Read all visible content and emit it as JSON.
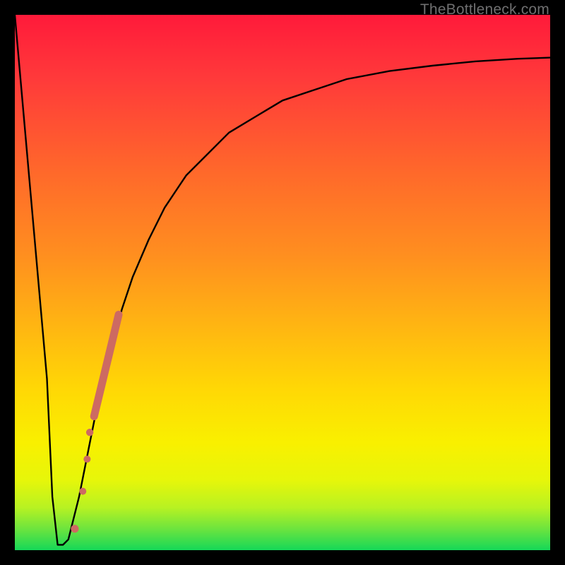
{
  "watermark": "TheBottleneck.com",
  "chart_data": {
    "type": "line",
    "title": "",
    "xlabel": "",
    "ylabel": "",
    "xlim": [
      0,
      100
    ],
    "ylim": [
      0,
      100
    ],
    "grid": false,
    "legend": false,
    "annotations": [
      {
        "text": "TheBottleneck.com",
        "position": "top-right"
      }
    ],
    "series": [
      {
        "name": "curve",
        "x": [
          0,
          6,
          7,
          8,
          9,
          10,
          12,
          14,
          16,
          18,
          20,
          22,
          25,
          28,
          32,
          36,
          40,
          45,
          50,
          56,
          62,
          70,
          78,
          86,
          94,
          100
        ],
        "values": [
          100,
          32,
          10,
          1,
          1,
          2,
          10,
          20,
          30,
          38,
          45,
          51,
          58,
          64,
          70,
          74,
          78,
          81,
          84,
          86,
          88,
          89.5,
          90.5,
          91.3,
          91.8,
          92
        ]
      }
    ],
    "points": [
      {
        "x": 14.0,
        "y": 22.0,
        "r": 2.6
      },
      {
        "x": 13.5,
        "y": 17.0,
        "r": 2.6
      },
      {
        "x": 12.7,
        "y": 11.0,
        "r": 2.6
      },
      {
        "x": 11.2,
        "y": 4.0,
        "r": 2.8
      }
    ],
    "thick_segment": {
      "x_start": 14.8,
      "y_start": 25.0,
      "x_end": 19.4,
      "y_end": 44.0
    },
    "background_gradient": {
      "orientation": "vertical",
      "stops": [
        {
          "pos": 0,
          "color": "#ff1a3a"
        },
        {
          "pos": 30,
          "color": "#ff6a2a"
        },
        {
          "pos": 58,
          "color": "#ffb512"
        },
        {
          "pos": 80,
          "color": "#f9f000"
        },
        {
          "pos": 96,
          "color": "#6de43e"
        },
        {
          "pos": 100,
          "color": "#15d858"
        }
      ]
    }
  }
}
